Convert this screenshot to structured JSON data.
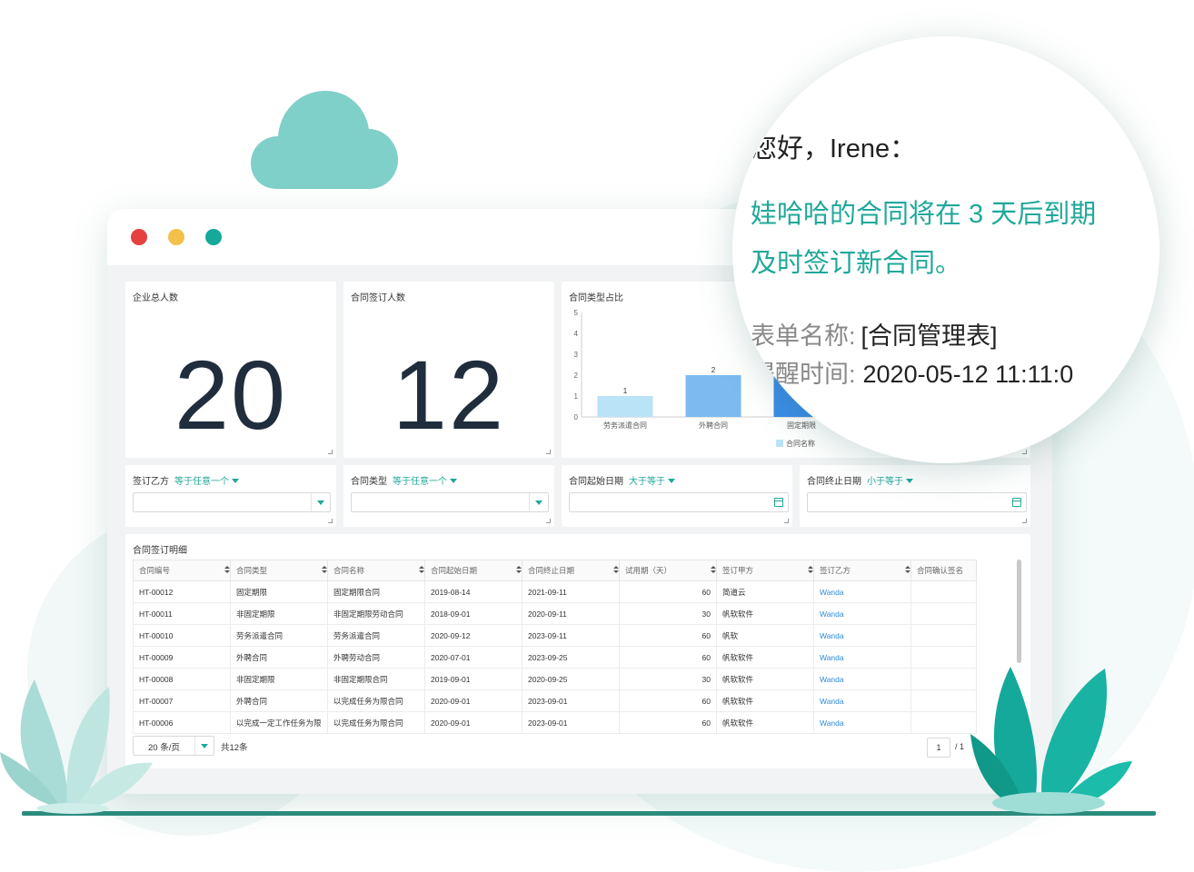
{
  "cards": {
    "total_staff": {
      "title": "企业总人数",
      "value": "20"
    },
    "signed_count": {
      "title": "合同签订人数",
      "value": "12"
    },
    "type_ratio": {
      "title": "合同类型占比"
    }
  },
  "chart_data": {
    "type": "bar",
    "title": "合同类型占比",
    "categories": [
      "劳务派遣合同",
      "外聘合同",
      "固定期限"
    ],
    "values": [
      1,
      2,
      3
    ],
    "ylim": [
      0,
      5
    ],
    "yticks": [
      "0",
      "1",
      "2",
      "3",
      "4",
      "5"
    ],
    "data_labels": [
      "1",
      "2"
    ],
    "legend": "合同名称",
    "legend_position": "bottom",
    "colors": [
      "#b9e3f6",
      "#7cbaf0",
      "#3b8de8"
    ],
    "grid": false
  },
  "filters": [
    {
      "label": "签订乙方",
      "op": "等于任意一个",
      "kind": "select"
    },
    {
      "label": "合同类型",
      "op": "等于任意一个",
      "kind": "select"
    },
    {
      "label": "合同起始日期",
      "op": "大于等于",
      "kind": "date"
    },
    {
      "label": "合同终止日期",
      "op": "小于等于",
      "kind": "date"
    }
  ],
  "table": {
    "title": "合同签订明细",
    "columns": [
      "合同编号",
      "合同类型",
      "合同名称",
      "合同起始日期",
      "合同终止日期",
      "试用期（天）",
      "签订甲方",
      "签订乙方",
      "合同确认签名"
    ],
    "rows": [
      [
        "HT-00012",
        "固定期限",
        "固定期限合同",
        "2019-08-14",
        "2021-09-11",
        "60",
        "简道云",
        "Wanda",
        ""
      ],
      [
        "HT-00011",
        "非固定期限",
        "非固定期限劳动合同",
        "2018-09-01",
        "2020-09-11",
        "30",
        "帆软软件",
        "Wanda",
        ""
      ],
      [
        "HT-00010",
        "劳务派遣合同",
        "劳务派遣合同",
        "2020-09-12",
        "2023-09-11",
        "60",
        "帆软",
        "Wanda",
        ""
      ],
      [
        "HT-00009",
        "外聘合同",
        "外聘劳动合同",
        "2020-07-01",
        "2023-09-25",
        "60",
        "帆软软件",
        "Wanda",
        ""
      ],
      [
        "HT-00008",
        "非固定期限",
        "非固定期限合同",
        "2019-09-01",
        "2020-09-25",
        "30",
        "帆软软件",
        "Wanda",
        ""
      ],
      [
        "HT-00007",
        "外聘合同",
        "以完成任务为限合同",
        "2020-09-01",
        "2023-09-01",
        "60",
        "帆软软件",
        "Wanda",
        ""
      ],
      [
        "HT-00006",
        "以完成一定工作任务为限",
        "以完成任务为限合同",
        "2020-09-01",
        "2023-09-01",
        "60",
        "帆软软件",
        "Wanda",
        ""
      ]
    ],
    "page_size": "20 条/页",
    "total": "共12条",
    "page_current": "1",
    "page_total": "/ 1"
  },
  "notification": {
    "greeting": "您好，Irene：",
    "message_line1": "娃哈哈的合同将在 3 天后到期",
    "message_line2": "及时签订新合同。",
    "form_name_label": "表单名称:",
    "form_name_value": "[合同管理表]",
    "remind_time_label": "提醒时间:",
    "remind_time_value": "2020-05-12 11:11:0"
  },
  "colors": {
    "accent": "#20a89a",
    "dark_number": "#1f2d3d",
    "window_dot_red": "#e5413f",
    "window_dot_yellow": "#f4c04c",
    "window_dot_teal": "#14a99a",
    "link": "#2d8ad8"
  }
}
